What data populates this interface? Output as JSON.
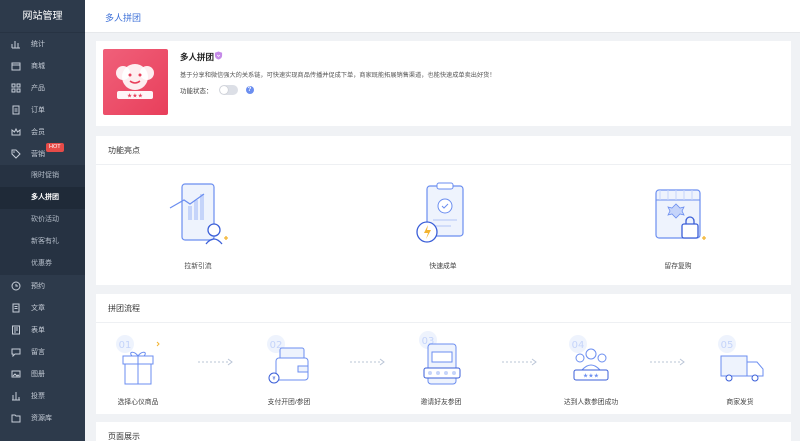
{
  "brand": "网站管理",
  "sidebar": {
    "items": [
      {
        "label": "统计",
        "icon": "chart-icon"
      },
      {
        "label": "商城",
        "icon": "store-icon"
      },
      {
        "label": "产品",
        "icon": "grid-icon"
      },
      {
        "label": "订单",
        "icon": "clipboard-icon"
      },
      {
        "label": "会员",
        "icon": "crown-icon"
      },
      {
        "label": "营销",
        "icon": "tag-icon",
        "badge": "HOT"
      }
    ],
    "sub_items": [
      "限时促销",
      "多人拼团",
      "砍价活动",
      "新客有礼",
      "优惠券"
    ],
    "items_after": [
      {
        "label": "预约",
        "icon": "clock-icon"
      },
      {
        "label": "文章",
        "icon": "document-icon"
      },
      {
        "label": "表单",
        "icon": "form-icon"
      },
      {
        "label": "留言",
        "icon": "message-icon"
      },
      {
        "label": "图册",
        "icon": "image-icon"
      },
      {
        "label": "投票",
        "icon": "bar-chart-icon"
      },
      {
        "label": "资源库",
        "icon": "folder-icon"
      }
    ]
  },
  "topbar": {
    "title": "多人拼团"
  },
  "plugin": {
    "name": "多人拼团",
    "description": "基于分享和微信强大的关系链，可快速实现商品传播并促成下单，商家既能拓展销售渠道，也能快速成单卖出好货！",
    "status_label": "功能状态：",
    "help": "?"
  },
  "features": {
    "title": "功能亮点",
    "items": [
      "拉新引流",
      "快速成单",
      "留存复购"
    ]
  },
  "process": {
    "title": "拼团流程",
    "steps": [
      {
        "num": "01",
        "label": "选择心仪商品"
      },
      {
        "num": "02",
        "label": "支付开团/参团"
      },
      {
        "num": "03",
        "label": "邀请好友参团"
      },
      {
        "num": "04",
        "label": "达到人数参团成功"
      },
      {
        "num": "05",
        "label": "商家发货"
      }
    ]
  },
  "showcase": {
    "title": "页面展示"
  },
  "colors": {
    "accent": "#3b6fd8",
    "sidebar": "#2d3a4b",
    "hot": "#e64b48",
    "logo": "#ec4d67"
  }
}
